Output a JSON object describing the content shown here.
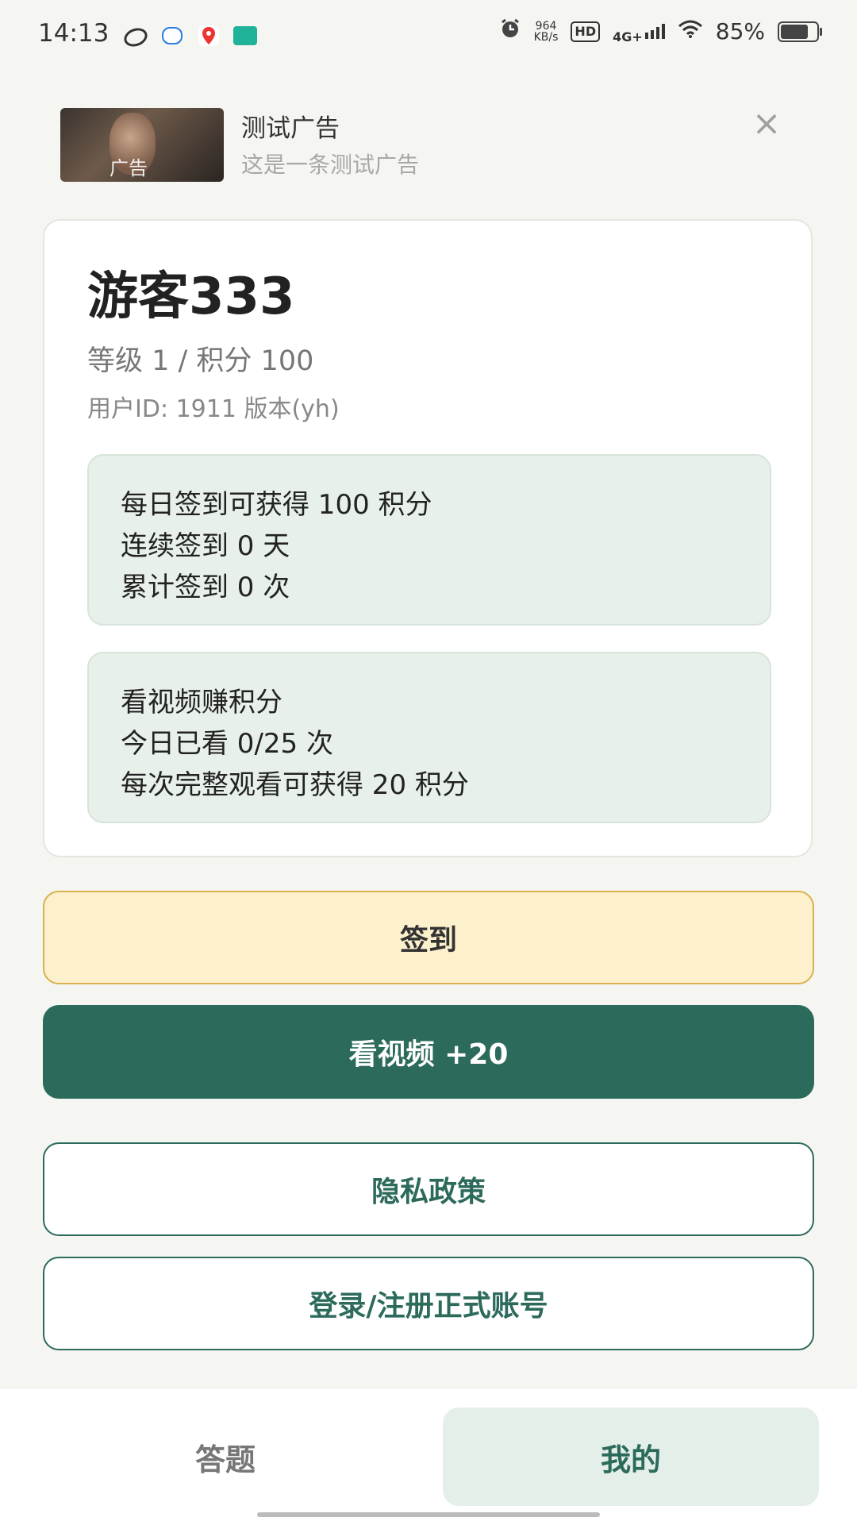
{
  "status_bar": {
    "time": "14:13",
    "net_speed_value": "964",
    "net_speed_unit": "KB/s",
    "hd": "HD",
    "network": "4G+",
    "battery": "85%",
    "battery_level": 0.85,
    "icons": [
      "app-icon-1",
      "chat-icon",
      "map-pin-icon",
      "boss-app-icon",
      "alarm-icon",
      "signal-icon",
      "wifi-icon",
      "battery-icon"
    ]
  },
  "ad": {
    "tag": "广告",
    "title": "测试广告",
    "subtitle": "这是一条测试广告"
  },
  "profile": {
    "username": "游客333",
    "level_points": "等级 1 / 积分 100",
    "user_id_version": "用户ID: 1911  版本(yh)"
  },
  "sign_in_info": {
    "line1": "每日签到可获得 100 积分",
    "line2": "连续签到 0 天",
    "line3": "累计签到 0 次"
  },
  "video_info": {
    "line1": "看视频赚积分",
    "line2": "今日已看 0/25 次",
    "line3": "每次完整观看可获得 20 积分"
  },
  "buttons": {
    "sign_in": "签到",
    "watch_video": "看视频 +20",
    "privacy": "隐私政策",
    "login": "登录/注册正式账号"
  },
  "nav": {
    "quiz": "答题",
    "mine": "我的",
    "active": "我的"
  },
  "colors": {
    "primary": "#2c6a5c",
    "sign_bg": "#fdf0cc",
    "info_bg": "#e8f0ea"
  }
}
